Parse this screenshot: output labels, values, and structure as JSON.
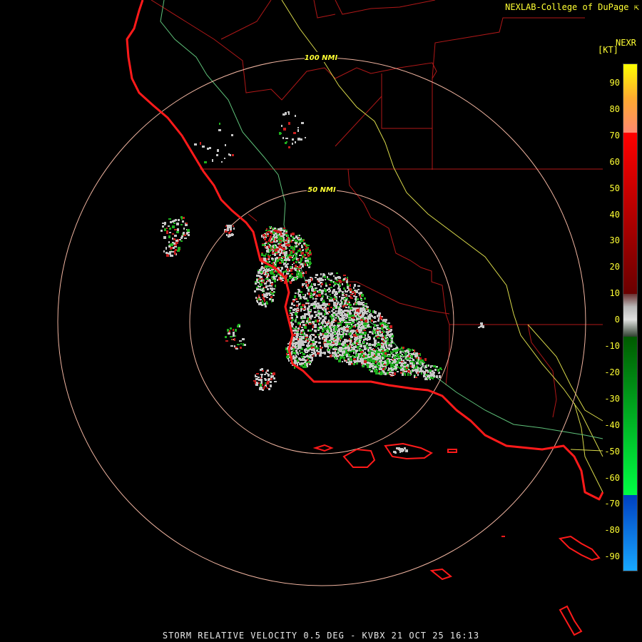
{
  "header": {
    "credit": "NEXLAB-College of DuPage"
  },
  "legend": {
    "product": "NEXR",
    "unit": "[KT]",
    "ticks": [
      "90",
      "80",
      "70",
      "60",
      "50",
      "40",
      "30",
      "20",
      "10",
      "0",
      "-10",
      "-20",
      "-30",
      "-40",
      "-50",
      "-60",
      "-70",
      "-80",
      "-90"
    ]
  },
  "rings": [
    {
      "label": "100 NMI",
      "range_nmi": 100
    },
    {
      "label": "50 NMI",
      "range_nmi": 50
    }
  ],
  "footer": {
    "title": "STORM RELATIVE VELOCITY 0.5 DEG - KVBX 21 OCT 25 16:13"
  },
  "colors": {
    "coastline": "#ff1a1a",
    "county_lines": "#b01818",
    "highway_yellow": "#d8d84a",
    "highway_green": "#5fc27a",
    "range_rings": "#f0b4a0",
    "inbound": "#1fb01f",
    "outbound": "#c81e1e",
    "near_zero": "#c8c8c8"
  }
}
